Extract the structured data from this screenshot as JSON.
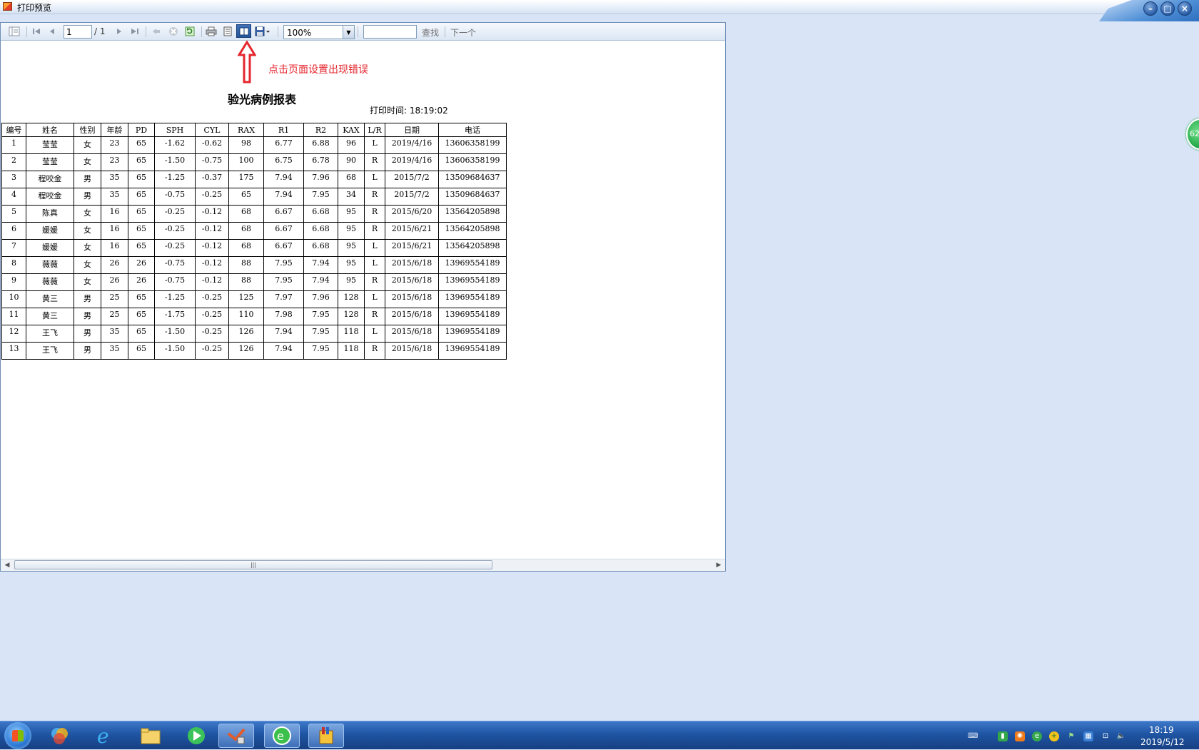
{
  "window": {
    "title": "打印预览"
  },
  "toolbar": {
    "page_current": "1",
    "page_total": "/ 1",
    "zoom": "100%",
    "search_placeholder": "",
    "find_label": "查找",
    "next_label": "下一个"
  },
  "annotation": {
    "text": "点击页面设置出现错误"
  },
  "report": {
    "title": "验光病例报表",
    "print_time": "打印时间: 18:19:02",
    "columns": [
      "编号",
      "姓名",
      "性别",
      "年龄",
      "PD",
      "SPH",
      "CYL",
      "RAX",
      "R1",
      "R2",
      "KAX",
      "L/R",
      "日期",
      "电话"
    ],
    "rows": [
      [
        "1",
        "莹莹",
        "女",
        "23",
        "65",
        "-1.62",
        "-0.62",
        "98",
        "6.77",
        "6.88",
        "96",
        "L",
        "2019/4/16",
        "13606358199"
      ],
      [
        "2",
        "莹莹",
        "女",
        "23",
        "65",
        "-1.50",
        "-0.75",
        "100",
        "6.75",
        "6.78",
        "90",
        "R",
        "2019/4/16",
        "13606358199"
      ],
      [
        "3",
        "程咬金",
        "男",
        "35",
        "65",
        "-1.25",
        "-0.37",
        "175",
        "7.94",
        "7.96",
        "68",
        "L",
        "2015/7/2",
        "13509684637"
      ],
      [
        "4",
        "程咬金",
        "男",
        "35",
        "65",
        "-0.75",
        "-0.25",
        "65",
        "7.94",
        "7.95",
        "34",
        "R",
        "2015/7/2",
        "13509684637"
      ],
      [
        "5",
        "陈真",
        "女",
        "16",
        "65",
        "-0.25",
        "-0.12",
        "68",
        "6.67",
        "6.68",
        "95",
        "R",
        "2015/6/20",
        "13564205898"
      ],
      [
        "6",
        "媛媛",
        "女",
        "16",
        "65",
        "-0.25",
        "-0.12",
        "68",
        "6.67",
        "6.68",
        "95",
        "R",
        "2015/6/21",
        "13564205898"
      ],
      [
        "7",
        "媛媛",
        "女",
        "16",
        "65",
        "-0.25",
        "-0.12",
        "68",
        "6.67",
        "6.68",
        "95",
        "L",
        "2015/6/21",
        "13564205898"
      ],
      [
        "8",
        "薇薇",
        "女",
        "26",
        "26",
        "-0.75",
        "-0.12",
        "88",
        "7.95",
        "7.94",
        "95",
        "L",
        "2015/6/18",
        "13969554189"
      ],
      [
        "9",
        "薇薇",
        "女",
        "26",
        "26",
        "-0.75",
        "-0.12",
        "88",
        "7.95",
        "7.94",
        "95",
        "R",
        "2015/6/18",
        "13969554189"
      ],
      [
        "10",
        "黄三",
        "男",
        "25",
        "65",
        "-1.25",
        "-0.25",
        "125",
        "7.97",
        "7.96",
        "128",
        "L",
        "2015/6/18",
        "13969554189"
      ],
      [
        "11",
        "黄三",
        "男",
        "25",
        "65",
        "-1.75",
        "-0.25",
        "110",
        "7.98",
        "7.95",
        "128",
        "R",
        "2015/6/18",
        "13969554189"
      ],
      [
        "12",
        "王飞",
        "男",
        "35",
        "65",
        "-1.50",
        "-0.25",
        "126",
        "7.94",
        "7.95",
        "118",
        "L",
        "2015/6/18",
        "13969554189"
      ],
      [
        "13",
        "王飞",
        "男",
        "35",
        "65",
        "-1.50",
        "-0.25",
        "126",
        "7.94",
        "7.95",
        "118",
        "R",
        "2015/6/18",
        "13969554189"
      ]
    ]
  },
  "badge": {
    "text": "62"
  },
  "taskbar": {
    "clock_time": "18:19",
    "clock_date": "2019/5/12"
  },
  "colors": {
    "annotation_red": "#e4272f",
    "desktop_bg": "#d9e5f7",
    "taskbar_blue": "#1f55a3"
  }
}
